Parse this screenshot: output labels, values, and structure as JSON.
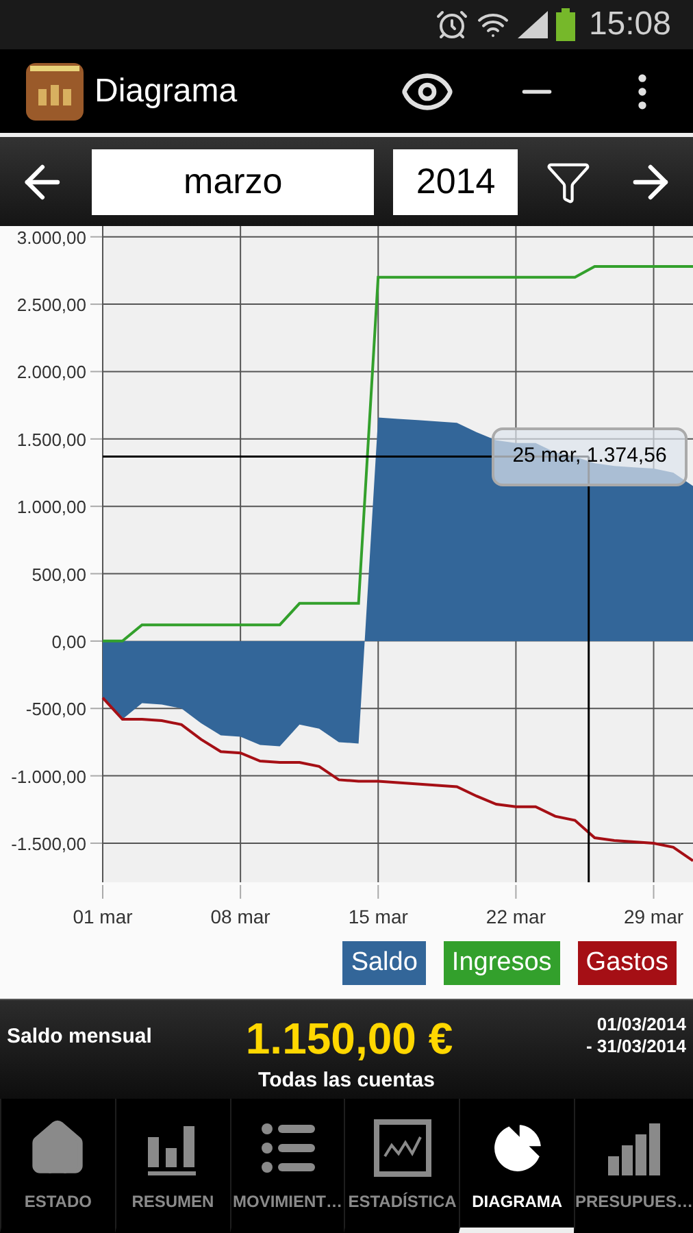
{
  "status_bar": {
    "time": "15:08"
  },
  "action_bar": {
    "title": "Diagrama"
  },
  "period_nav": {
    "month": "marzo",
    "year": "2014"
  },
  "chart": {
    "chart_data": {
      "type": "line",
      "categories": [
        "01 mar",
        null,
        null,
        null,
        null,
        null,
        null,
        "08 mar",
        null,
        null,
        null,
        null,
        null,
        null,
        "15 mar",
        null,
        null,
        null,
        null,
        null,
        null,
        "22 mar",
        null,
        null,
        null,
        null,
        null,
        null,
        "29 mar",
        null,
        null
      ],
      "series": [
        {
          "name": "Saldo",
          "type": "area",
          "color": "#336699",
          "values": [
            -420,
            -580,
            -460,
            -470,
            -500,
            -610,
            -700,
            -710,
            -770,
            -780,
            -620,
            -650,
            -750,
            -760,
            1660,
            1650,
            1640,
            1630,
            1620,
            1550,
            1490,
            1470,
            1470,
            1400,
            1370,
            1320,
            1300,
            1290,
            1280,
            1250,
            1150
          ]
        },
        {
          "name": "Ingresos",
          "type": "line",
          "color": "#33a02c",
          "values": [
            0,
            0,
            120,
            120,
            120,
            120,
            120,
            120,
            120,
            120,
            280,
            280,
            280,
            280,
            2700,
            2700,
            2700,
            2700,
            2700,
            2700,
            2700,
            2700,
            2700,
            2700,
            2700,
            2780,
            2780,
            2780,
            2780,
            2780,
            2780
          ]
        },
        {
          "name": "Gastos",
          "type": "line",
          "color": "#a50f15",
          "values": [
            -420,
            -580,
            -580,
            -590,
            -620,
            -730,
            -820,
            -830,
            -890,
            -900,
            -900,
            -930,
            -1030,
            -1040,
            -1040,
            -1050,
            -1060,
            -1070,
            -1080,
            -1150,
            -1210,
            -1230,
            -1230,
            -1300,
            -1330,
            -1460,
            -1480,
            -1490,
            -1500,
            -1530,
            -1630
          ]
        }
      ],
      "ylim": [
        -1790,
        3080
      ],
      "grid": true,
      "ref_lines": [
        {
          "axis": "y",
          "value": 1370
        }
      ],
      "yticks": [
        {
          "value": 3000,
          "label": "3.000,00"
        },
        {
          "value": 2500,
          "label": "2.500,00"
        },
        {
          "value": 2000,
          "label": "2.000,00"
        },
        {
          "value": 1500,
          "label": "1.500,00"
        },
        {
          "value": 1000,
          "label": "1.000,00"
        },
        {
          "value": 500,
          "label": "500,00"
        },
        {
          "value": 0,
          "label": "0,00"
        },
        {
          "value": -500,
          "label": "-500,00"
        },
        {
          "value": -1000,
          "label": "-1.000,00"
        },
        {
          "value": -1500,
          "label": "-1.500,00"
        }
      ],
      "annotations": [
        "25 mar, 1.374,56"
      ]
    }
  },
  "summary": {
    "label": "Saldo mensual",
    "amount": "1.150,00 €",
    "date_from": "01/03/2014",
    "date_to": "- 31/03/2014",
    "accounts": "Todas las cuentas"
  },
  "tabs": [
    {
      "label": "ESTADO",
      "selected": false
    },
    {
      "label": "RESUMEN",
      "selected": false
    },
    {
      "label": "MOVIMIENT…",
      "selected": false
    },
    {
      "label": "ESTADÍSTICA",
      "selected": false
    },
    {
      "label": "DIAGRAMA",
      "selected": true
    },
    {
      "label": "PRESUPUES…",
      "selected": false
    }
  ]
}
